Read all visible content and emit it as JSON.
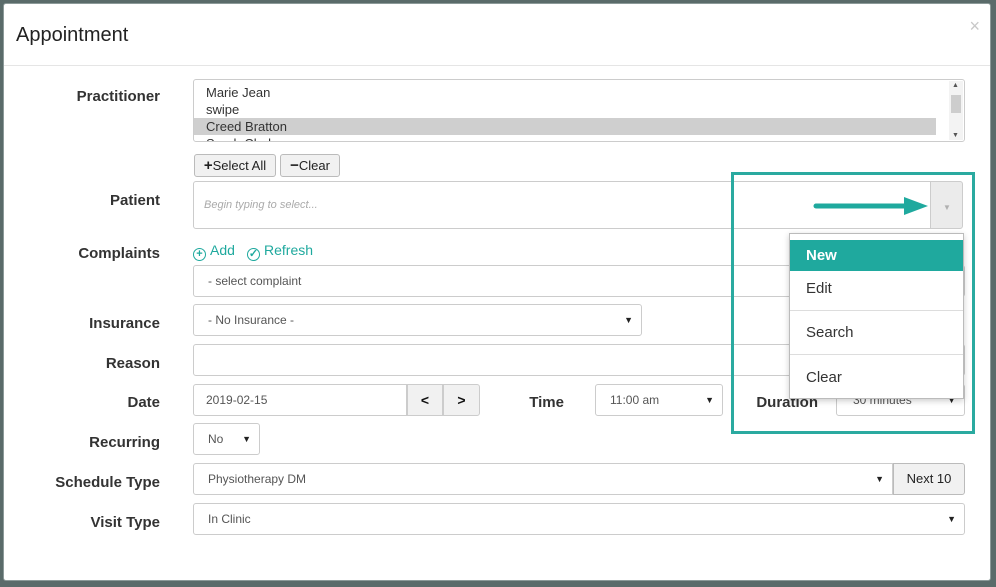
{
  "modal": {
    "title": "Appointment",
    "close": "×"
  },
  "labels": {
    "practitioner": "Practitioner",
    "patient": "Patient",
    "complaints": "Complaints",
    "insurance": "Insurance",
    "reason": "Reason",
    "date": "Date",
    "time": "Time",
    "duration": "Duration",
    "recurring": "Recurring",
    "schedule_type": "Schedule Type",
    "visit_type": "Visit Type"
  },
  "practitioners": [
    {
      "name": "Marie Jean",
      "selected": false
    },
    {
      "name": "swipe",
      "selected": false
    },
    {
      "name": "Creed Bratton",
      "selected": true
    },
    {
      "name": "Sarah Clark",
      "selected": false
    }
  ],
  "practitioner_buttons": {
    "select_all": "Select All",
    "clear": "Clear"
  },
  "patient": {
    "placeholder": "Begin typing to select..."
  },
  "patient_menu": {
    "items": [
      "New",
      "Edit",
      "Search",
      "Clear"
    ],
    "active": "New"
  },
  "complaints": {
    "add": "Add",
    "refresh": "Refresh",
    "placeholder": "- select complaint"
  },
  "insurance": {
    "value": "- No Insurance -"
  },
  "reason": {
    "value": ""
  },
  "date": {
    "value": "2019-02-15"
  },
  "time": {
    "value": "11:00 am"
  },
  "duration": {
    "value": "30 minutes"
  },
  "recurring": {
    "value": "No"
  },
  "schedule_type": {
    "value": "Physiotherapy DM",
    "next_button": "Next 10"
  },
  "visit_type": {
    "value": "In Clinic"
  },
  "colors": {
    "accent": "#1fa99e",
    "highlight_border": "#2aaaa0"
  }
}
